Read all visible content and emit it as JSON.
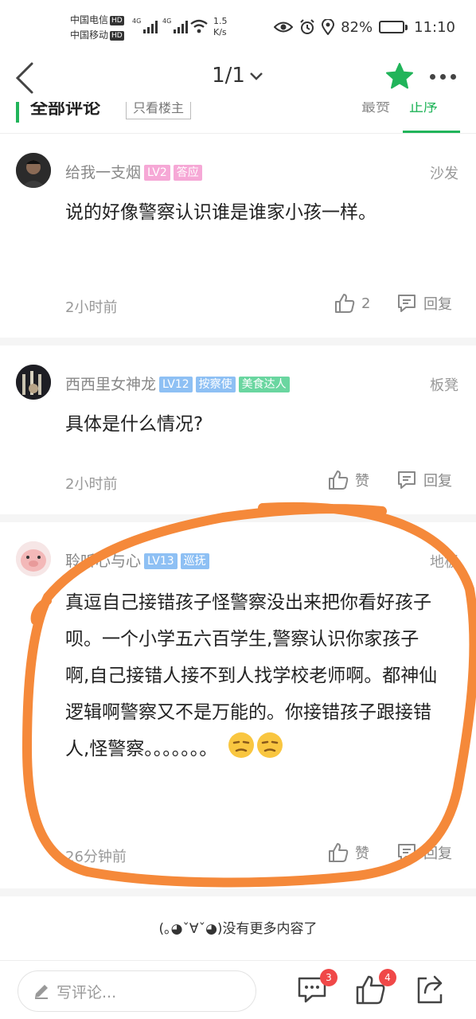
{
  "status_bar": {
    "carrier1": "中国电信",
    "carrier2": "中国移动",
    "hd": "HD",
    "sig_label": "4G",
    "net_speed_value": "1.5",
    "net_speed_unit": "K/s",
    "battery": "82%",
    "battery_level": 0.82,
    "time": "11:10"
  },
  "nav": {
    "page_indicator": "1/1"
  },
  "sort_strip": {
    "all_comments": "全部评论",
    "only_owner": "只看楼主",
    "hot": "最赞",
    "order": "正序"
  },
  "comments": [
    {
      "user": "给我一支烟",
      "badges": [
        {
          "text": "LV2",
          "color": "#f6a8d6"
        },
        {
          "text": "答应",
          "color": "#f6a8d6"
        }
      ],
      "floor": "沙发",
      "text": "说的好像警察认识谁是谁家小孩一样。",
      "time": "2小时前",
      "likes": "2",
      "reply": "回复"
    },
    {
      "user": "西西里女神龙",
      "badges": [
        {
          "text": "LV12",
          "color": "#8ec0f4"
        },
        {
          "text": "按察使",
          "color": "#8ec0f4"
        },
        {
          "text": "美食达人",
          "color": "#6ad6a0"
        }
      ],
      "floor": "板凳",
      "text": "具体是什么情况?",
      "time": "2小时前",
      "likes": "赞",
      "reply": "回复"
    },
    {
      "user": "聆听心与心",
      "badges": [
        {
          "text": "LV13",
          "color": "#8ec0f4"
        },
        {
          "text": "巡抚",
          "color": "#8ec0f4"
        }
      ],
      "floor": "地板",
      "text": "真逗自己接错孩子怪警察没出来把你看好孩子呗。一个小学五六百学生,警察认识你家孩子啊,自己接错人接不到人找学校老师啊。都神仙逻辑啊警察又不是万能的。你接错孩子跟接错人,怪警察。。。。。。。",
      "time": "26分钟前",
      "likes": "赞",
      "reply": "回复"
    }
  ],
  "no_more": "(｡◕ˇ∀ˇ◕)没有更多内容了",
  "bottom": {
    "input_placeholder": "写评论...",
    "comments_count": "3",
    "likes_count": "4"
  },
  "colors": {
    "accent_green": "#21b45a",
    "annotation_orange": "#f5893a",
    "badge_red": "#f04848"
  }
}
